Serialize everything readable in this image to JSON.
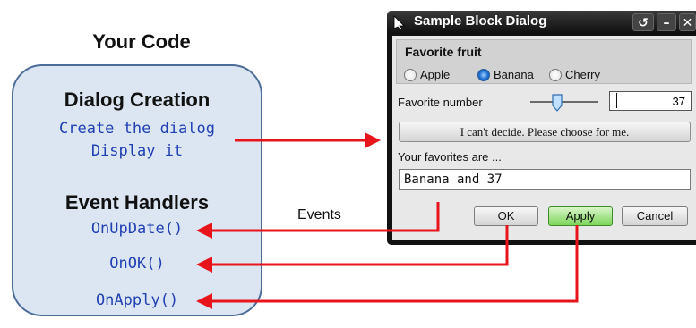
{
  "code_panel": {
    "title": "Your Code",
    "creation_heading": "Dialog Creation",
    "creation_lines": [
      "Create the dialog",
      "Display it"
    ],
    "handlers_heading": "Event Handlers",
    "handlers": [
      "OnUpDate()",
      "OnOK()",
      "OnApply()"
    ]
  },
  "events_label": "Events",
  "dialog": {
    "title": "Sample Block Dialog",
    "group_title": "Favorite fruit",
    "radio_options": [
      "Apple",
      "Banana",
      "Cherry"
    ],
    "selected_option": "Banana",
    "number_label": "Favorite number",
    "number_value": "37",
    "decide_button": "I can't decide. Please choose for me.",
    "favorites_label": "Your favorites are ...",
    "favorites_value": "Banana and 37",
    "buttons": {
      "ok": "OK",
      "apply": "Apply",
      "cancel": "Cancel"
    }
  },
  "colors": {
    "arrow": "#e8141b",
    "code_bg": "#dce6f2",
    "code_border": "#4b6d98",
    "code_text": "#1f3fb4",
    "apply_button": "#7cd55a"
  }
}
